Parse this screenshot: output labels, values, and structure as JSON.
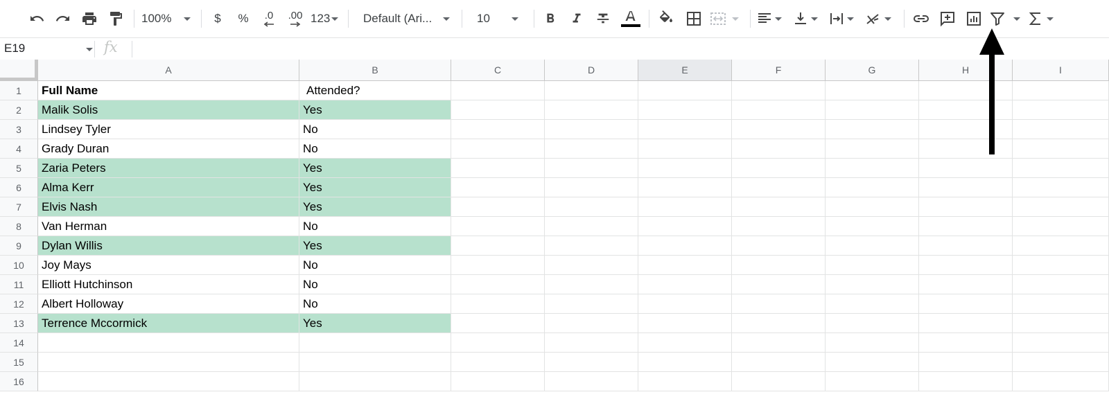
{
  "toolbar": {
    "zoom": "100%",
    "currency": "$",
    "percent": "%",
    "decrease_decimals": ".0",
    "increase_decimals": ".00",
    "more_formats": "123",
    "font": "Default (Ari...",
    "font_size": "10",
    "icons": [
      "undo-icon",
      "redo-icon",
      "print-icon",
      "paint-format-icon",
      "bold-icon",
      "italic-icon",
      "strikethrough-icon",
      "text-color-icon",
      "fill-color-icon",
      "borders-icon",
      "merge-cells-icon",
      "align-left-icon",
      "vertical-align-icon",
      "text-wrap-icon",
      "text-rotation-icon",
      "link-icon",
      "comment-icon",
      "chart-icon",
      "filter-icon",
      "functions-icon"
    ]
  },
  "formula_bar": {
    "name_box": "E19",
    "fx": "fx"
  },
  "columns": [
    "A",
    "B",
    "C",
    "D",
    "E",
    "F",
    "G",
    "H",
    "I"
  ],
  "selected_column": "E",
  "rows": [
    "1",
    "2",
    "3",
    "4",
    "5",
    "6",
    "7",
    "8",
    "9",
    "10",
    "11",
    "12",
    "13",
    "14",
    "15",
    "16"
  ],
  "cells": {
    "A1": "Full Name",
    "B1": "Attended?",
    "A2": "Malik Solis",
    "B2": "Yes",
    "A3": "Lindsey Tyler",
    "B3": "No",
    "A4": "Grady Duran",
    "B4": "No",
    "A5": "Zaria Peters",
    "B5": "Yes",
    "A6": "Alma Kerr",
    "B6": "Yes",
    "A7": "Elvis Nash",
    "B7": "Yes",
    "A8": "Van Herman",
    "B8": "No",
    "A9": "Dylan Willis",
    "B9": "Yes",
    "A10": "Joy Mays",
    "B10": "No",
    "A11": "Elliott Hutchinson",
    "B11": "No",
    "A12": "Albert Holloway",
    "B12": "No",
    "A13": "Terrence Mccormick",
    "B13": "Yes"
  },
  "highlight_color": "#b7e1cd",
  "highlighted_rows": [
    "2",
    "5",
    "6",
    "7",
    "9",
    "13"
  ],
  "annotation": {
    "arrow_color": "#000000",
    "points_to": "filter-icon"
  }
}
